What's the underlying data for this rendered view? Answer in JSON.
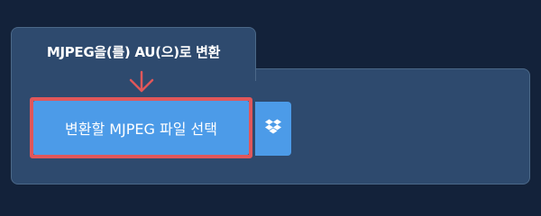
{
  "converter": {
    "title": "MJPEG을(를) AU(으)로 변환",
    "select_button_label": "변환할 MJPEG 파일 선택",
    "dropbox_icon": "dropbox-icon",
    "arrow_icon": "down-arrow-icon"
  },
  "colors": {
    "background": "#13223a",
    "card": "#2e4a6e",
    "button": "#4c9be8",
    "highlight": "#e0575a"
  }
}
